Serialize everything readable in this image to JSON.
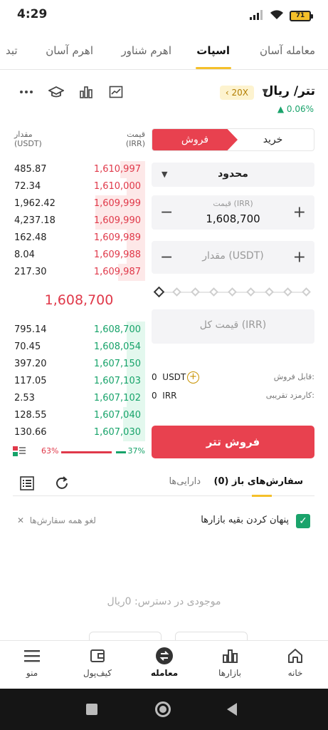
{
  "status": {
    "time": "4:29",
    "battery": "71"
  },
  "tabs": [
    {
      "label": "معامله آسان"
    },
    {
      "label": "اسپات"
    },
    {
      "label": "اهرم شناور"
    },
    {
      "label": "اهرم آسان"
    },
    {
      "label": "تبد"
    }
  ],
  "pair": {
    "title": "تتر/ ریال",
    "leverage": "20X",
    "leverage_arrow": "‹",
    "change": "0.06%"
  },
  "orderbook": {
    "price_header": [
      "قیمت",
      "(IRR)"
    ],
    "qty_header": [
      "مقدار",
      "(USDT)"
    ],
    "asks": [
      {
        "qty": "485.87",
        "price": "1,610,997",
        "depth": 0.5
      },
      {
        "qty": "72.34",
        "price": "1,610,000",
        "depth": 0.37
      },
      {
        "qty": "1,962.42",
        "price": "1,609,999",
        "depth": 1.0
      },
      {
        "qty": "4,237.18",
        "price": "1,609,990",
        "depth": 1.0
      },
      {
        "qty": "162.48",
        "price": "1,609,989",
        "depth": 0.37
      },
      {
        "qty": "8.04",
        "price": "1,609,988",
        "depth": 0.37
      },
      {
        "qty": "217.30",
        "price": "1,609,987",
        "depth": 0.54
      }
    ],
    "mid_price": "1,608,700",
    "bids": [
      {
        "qty": "795.14",
        "price": "1,608,700",
        "depth": 0.37
      },
      {
        "qty": "70.45",
        "price": "1,608,054",
        "depth": 0.37
      },
      {
        "qty": "397.20",
        "price": "1,607,150",
        "depth": 0.37
      },
      {
        "qty": "117.05",
        "price": "1,607,103",
        "depth": 0.37
      },
      {
        "qty": "2.53",
        "price": "1,607,102",
        "depth": 0.37
      },
      {
        "qty": "128.55",
        "price": "1,607,040",
        "depth": 0.44
      },
      {
        "qty": "130.66",
        "price": "1,607,030",
        "depth": 0.44
      }
    ],
    "sell_ratio": "63%",
    "buy_ratio": "37%",
    "colors": {
      "sell": "#e0394a",
      "buy": "#17a36a"
    }
  },
  "form": {
    "buy_label": "خرید",
    "sell_label": "فروش",
    "order_type": "محدود",
    "price_label": "قیمت (IRR)",
    "price_value": "1,608,700",
    "amount_placeholder": "مقدار (USDT)",
    "total_placeholder": "قیمت کل (IRR)",
    "available_label": "قابل فروش:",
    "available_value": "0",
    "available_unit": "USDT",
    "fee_label": "کارمزد تقریبی:",
    "fee_value": "0",
    "fee_unit": "IRR",
    "submit_label": "فروش تتر"
  },
  "orders": {
    "open_tab": "سفارش‌های باز (0)",
    "assets_tab": "دارایی‌ها",
    "hide_label": "پنهان کردن بقیه بازارها",
    "cancel_all": "لغو همه سفارش‌ها",
    "empty_msg": "موجودی در دسترس: 0ریال"
  },
  "bottom_nav": [
    {
      "label": "خانه",
      "icon": "home-icon"
    },
    {
      "label": "بازارها",
      "icon": "markets-icon"
    },
    {
      "label": "معامله",
      "icon": "trade-icon"
    },
    {
      "label": "کیف‌پول",
      "icon": "wallet-icon"
    },
    {
      "label": "منو",
      "icon": "menu-icon"
    }
  ]
}
